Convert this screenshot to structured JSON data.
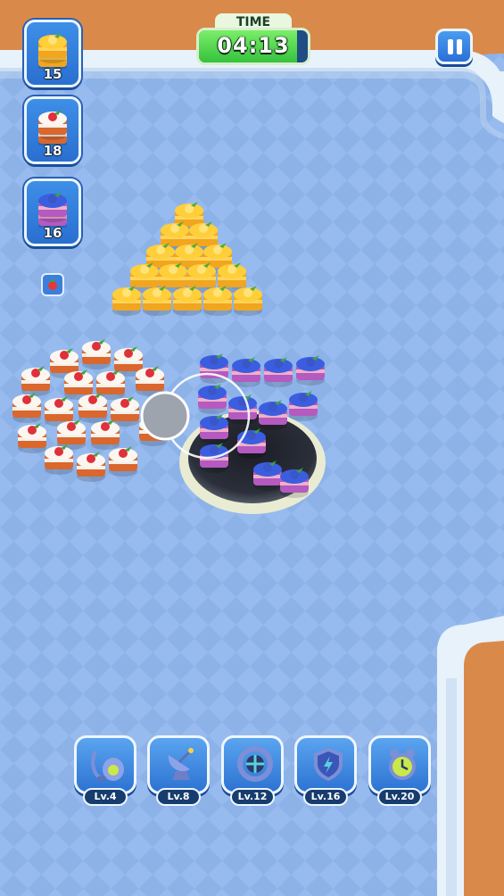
{
  "timer": {
    "label": "TIME",
    "value": "04:13",
    "remaining_fraction": 0.9
  },
  "goals": [
    {
      "item": "orange-cake",
      "count": "15"
    },
    {
      "item": "strawberry-cake",
      "count": "18"
    },
    {
      "item": "blueberry-cake",
      "count": "16"
    }
  ],
  "small_goal": {
    "item": "strawberry-cake"
  },
  "boosters": [
    {
      "icon": "vacuum-icon",
      "level": "Lv.4"
    },
    {
      "icon": "magnet-radar-icon",
      "level": "Lv.8"
    },
    {
      "icon": "expand-icon",
      "level": "Lv.12"
    },
    {
      "icon": "shield-icon",
      "level": "Lv.16"
    },
    {
      "icon": "alarm-clock-icon",
      "level": "Lv.20"
    }
  ],
  "colors": {
    "board": "#8fb4e9",
    "sand": "#d98a4a",
    "accent": "#2d73d3",
    "timer_fill": "#36c23d"
  }
}
